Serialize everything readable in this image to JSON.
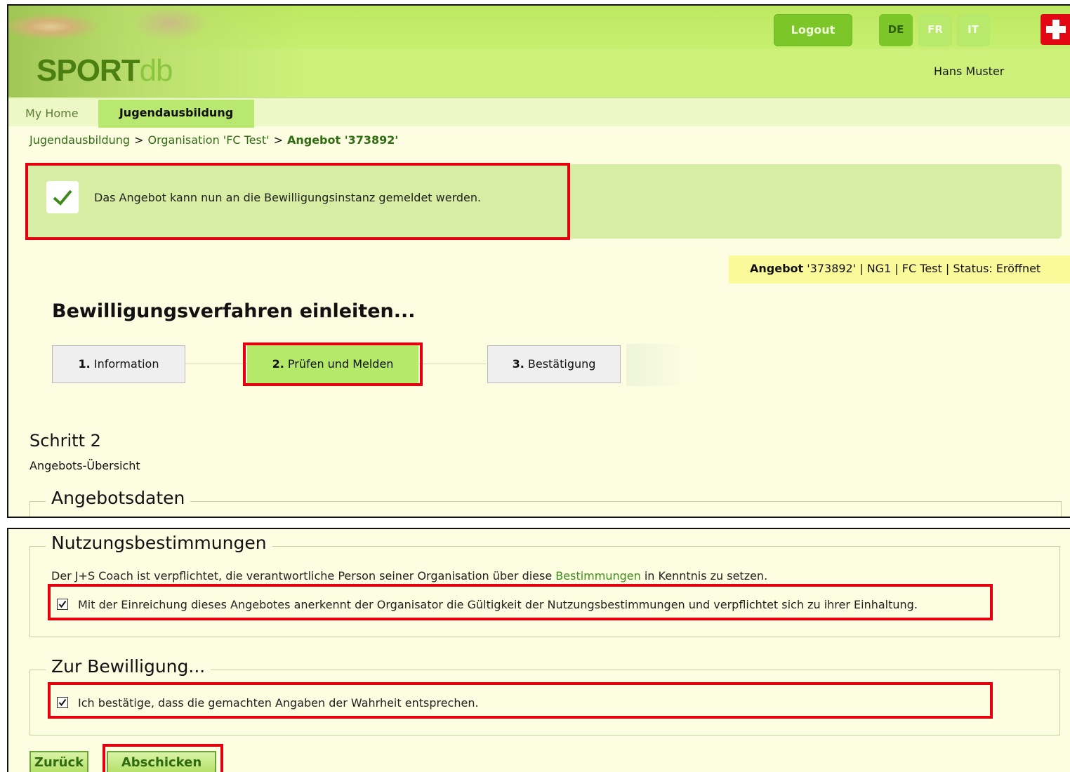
{
  "header": {
    "logo_main": "SPORT",
    "logo_suffix": "db",
    "logout_label": "Logout",
    "languages": [
      "DE",
      "FR",
      "IT"
    ],
    "user_name": "Hans Muster"
  },
  "nav": {
    "home_label": "My Home",
    "active_tab": "Jugendausbildung"
  },
  "breadcrumb": {
    "items": [
      "Jugendausbildung",
      "Organisation 'FC Test'",
      "Angebot '373892'"
    ],
    "separator": ">"
  },
  "message": {
    "text": "Das Angebot kann nun an die Bewilligungsinstanz gemeldet werden."
  },
  "status_bar": {
    "label": "Angebot",
    "text": " '373892' | NG1 | FC Test | Status: Eröffnet"
  },
  "page_title": "Bewilligungsverfahren einleiten...",
  "steps": [
    {
      "num": "1.",
      "label": "Information"
    },
    {
      "num": "2.",
      "label": "Prüfen und Melden"
    },
    {
      "num": "3.",
      "label": "Bestätigung"
    }
  ],
  "step_heading": "Schritt 2",
  "step_subheading": "Angebots-Übersicht",
  "section_angebotsdaten": "Angebotsdaten",
  "nutzung": {
    "legend": "Nutzungsbestimmungen",
    "text_before": "Der J+S Coach ist verpflichtet, die verantwortliche Person seiner Organisation über diese ",
    "link": "Bestimmungen",
    "text_after": " in Kenntnis zu setzen.",
    "checkbox_label": "Mit der Einreichung dieses Angebotes anerkennt der Organisator die Gültigkeit der Nutzungsbestimmungen und verpflichtet sich zu ihrer Einhaltung.",
    "checked": true
  },
  "bewilligung": {
    "legend": "Zur Bewilligung...",
    "checkbox_label": "Ich bestätige, dass die gemachten Angaben der Wahrheit entsprechen.",
    "checked": true
  },
  "buttons": {
    "back": "Zurück",
    "submit": "Abschicken"
  },
  "colors": {
    "accent_green": "#7cc62a",
    "highlight_red": "#e4000f",
    "panel_bg": "#fdfde2"
  }
}
